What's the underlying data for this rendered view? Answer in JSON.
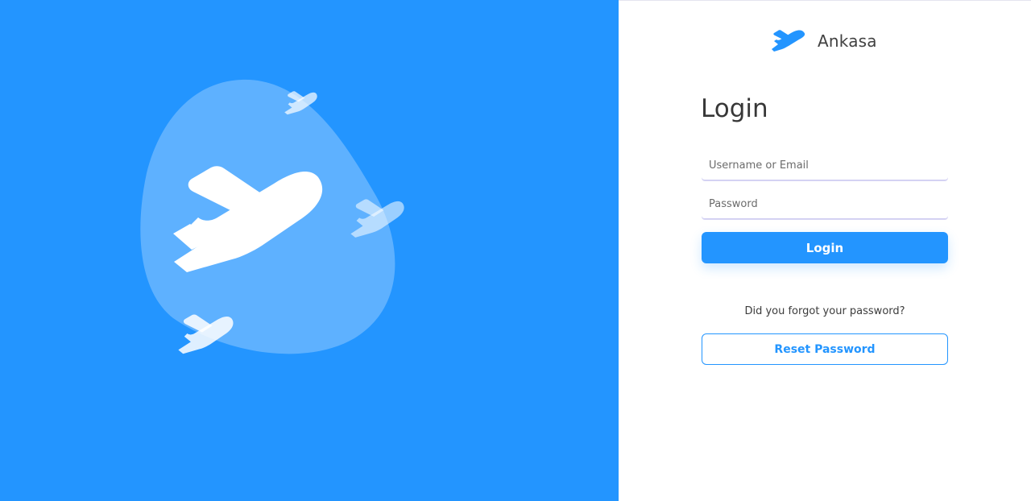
{
  "brand": {
    "name": "Ankasa",
    "logo_icon": "plane-icon",
    "accent_color": "#2395FF"
  },
  "hero": {
    "background_color": "#2395FF",
    "icons": [
      "plane-icon",
      "plane-icon",
      "plane-icon",
      "plane-icon"
    ]
  },
  "form": {
    "title": "Login",
    "username_placeholder": "Username or Email",
    "password_placeholder": "Password",
    "login_label": "Login",
    "forgot_text": "Did you forgot your password?",
    "reset_label": "Reset Password"
  }
}
